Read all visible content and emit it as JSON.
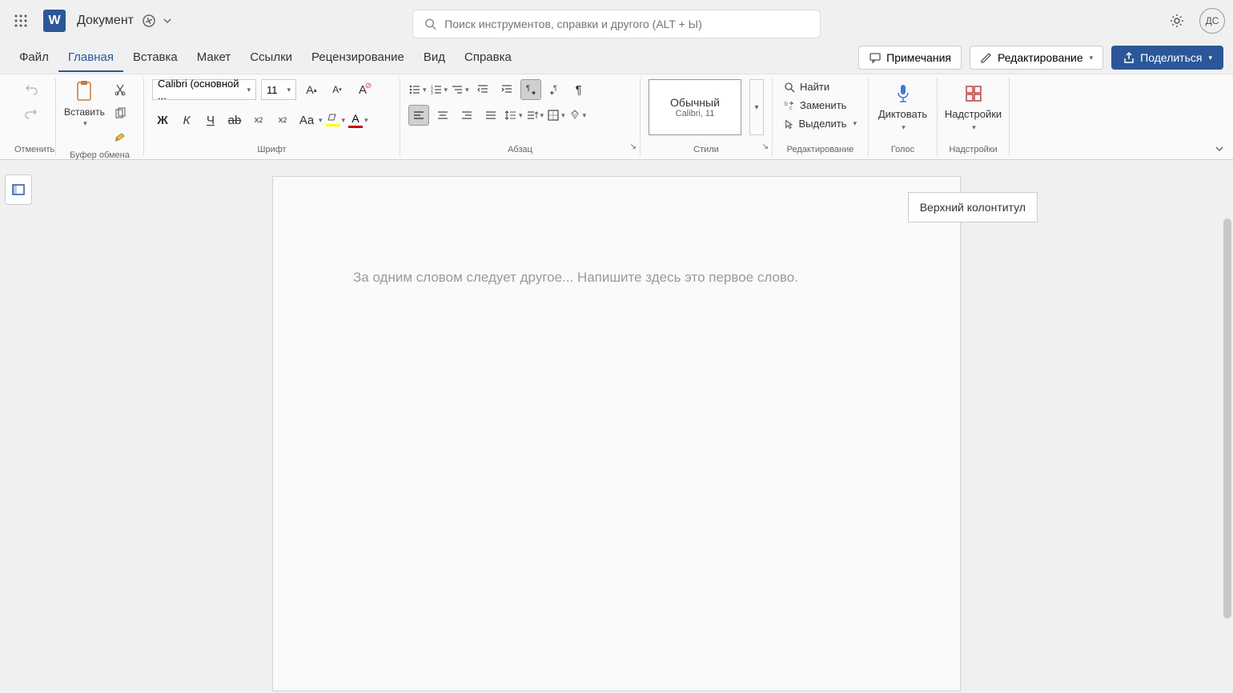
{
  "header": {
    "doc_name": "Документ",
    "search_placeholder": "Поиск инструментов, справки и другого (ALT + Ы)",
    "avatar_initials": "ДС"
  },
  "tabs": {
    "items": [
      "Файл",
      "Главная",
      "Вставка",
      "Макет",
      "Ссылки",
      "Рецензирование",
      "Вид",
      "Справка"
    ],
    "active_index": 1,
    "comments_label": "Примечания",
    "editing_label": "Редактирование",
    "share_label": "Поделиться"
  },
  "ribbon": {
    "undo_group_label": "Отменить",
    "clipboard": {
      "paste_label": "Вставить",
      "group_label": "Буфер обмена"
    },
    "font": {
      "name": "Calibri (основной ...",
      "size": "11",
      "group_label": "Шрифт"
    },
    "paragraph": {
      "group_label": "Абзац"
    },
    "styles": {
      "name": "Обычный",
      "detail": "Calibri, 11",
      "group_label": "Стили"
    },
    "editing": {
      "find": "Найти",
      "replace": "Заменить",
      "select": "Выделить",
      "group_label": "Редактирование"
    },
    "voice": {
      "dictate": "Диктовать",
      "group_label": "Голос"
    },
    "addins": {
      "label": "Надстройки",
      "group_label": "Надстройки"
    }
  },
  "document": {
    "placeholder": "За одним словом следует другое... Напишите здесь это первое слово.",
    "header_callout": "Верхний колонтитул"
  }
}
